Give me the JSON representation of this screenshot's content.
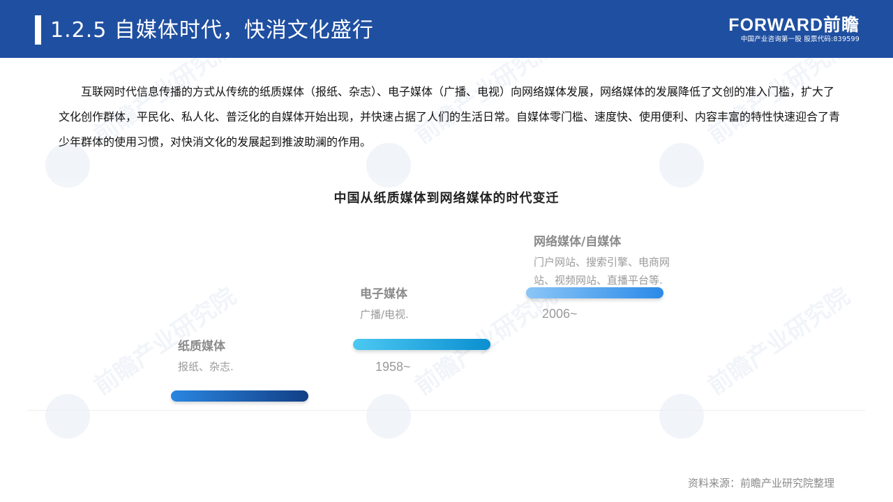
{
  "header": {
    "title": "1.2.5 自媒体时代，快消文化盛行",
    "logo_main": "FORWARD前瞻",
    "logo_sub": "中国产业咨询第一股 股票代码:839599"
  },
  "intro_text": "互联网时代信息传播的方式从传统的纸质媒体（报纸、杂志）、电子媒体（广播、电视）向网络媒体发展，网络媒体的发展降低了文创的准入门槛，扩大了文化创作群体，平民化、私人化、普泛化的自媒体开始出现，并快速占据了人们的生活日常。自媒体零门槛、速度快、使用便利、内容丰富的特性快速迎合了青少年群体的使用习惯，对快消文化的发展起到推波助澜的作用。",
  "diagram": {
    "title": "中国从纸质媒体到网络媒体的时代变迁",
    "stages": [
      {
        "title": "纸质媒体",
        "desc": "报纸、杂志.",
        "year": ""
      },
      {
        "title": "电子媒体",
        "desc": "广播/电视.",
        "year": "1958~"
      },
      {
        "title": "网络媒体/自媒体",
        "desc": "门户网站、搜索引擎、电商网站、视频网站、直播平台等.",
        "year": "2006~"
      }
    ]
  },
  "watermark_text": "前瞻产业研究院",
  "source": "资料来源：前瞻产业研究院整理",
  "colors": {
    "header_bg": "#1f4fa0",
    "bar_paper": "#1a4f9c",
    "bar_electronic": "#1aa7e0",
    "bar_network": "#5aa8ee"
  }
}
